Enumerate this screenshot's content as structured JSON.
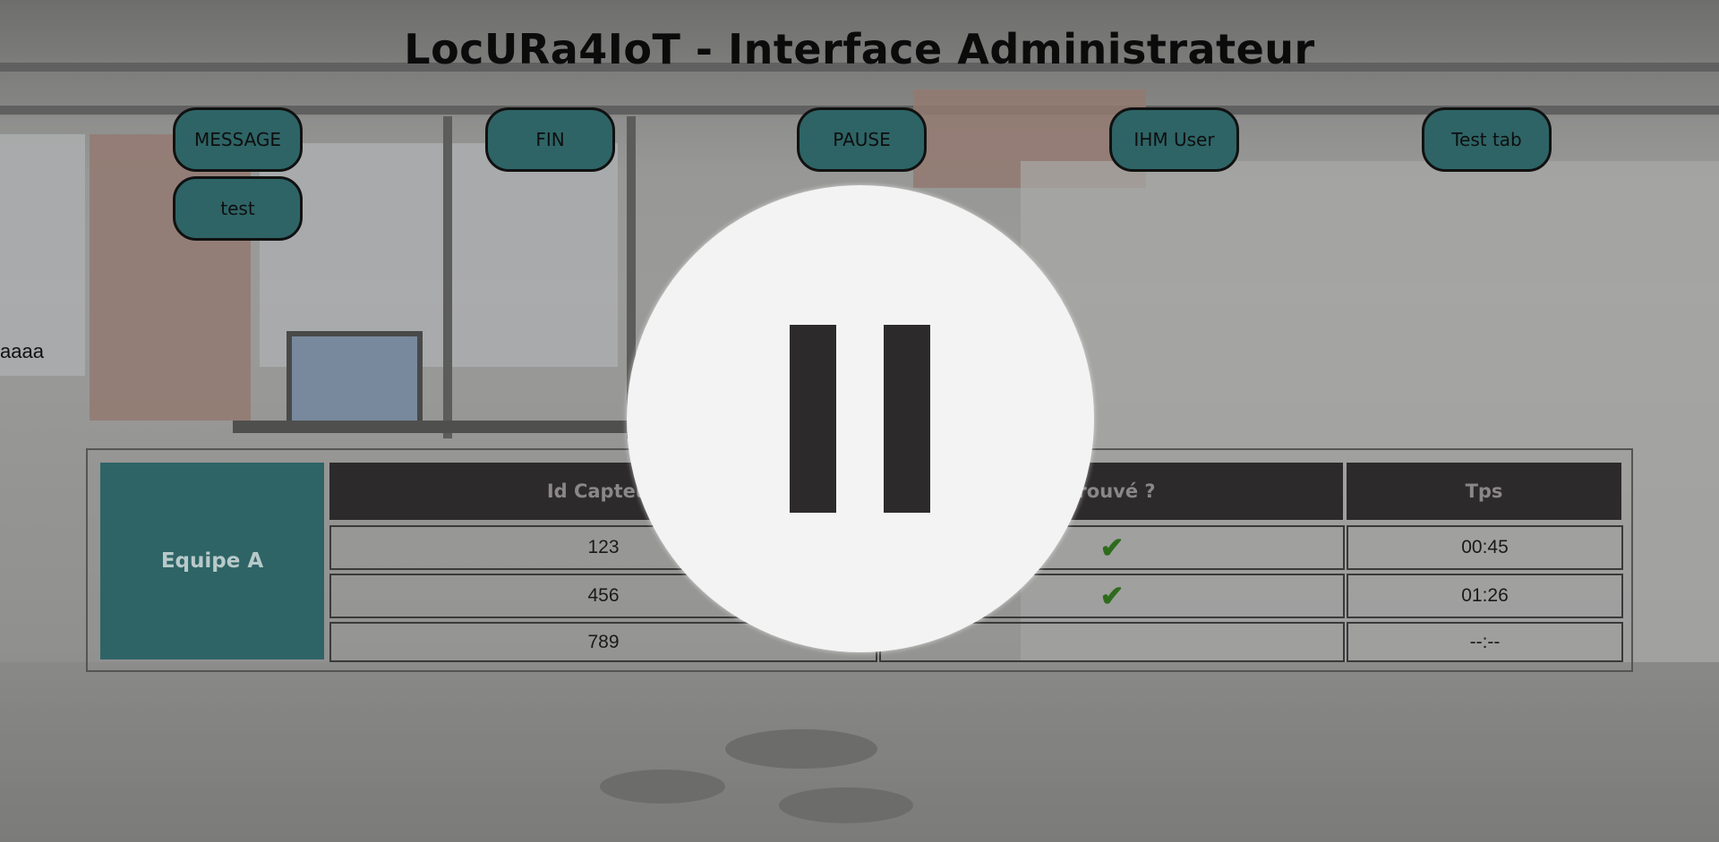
{
  "header": {
    "title": "LocURa4IoT - Interface Administrateur"
  },
  "buttons": {
    "message": "MESSAGE",
    "fin": "FIN",
    "pause": "PAUSE",
    "ihm_user": "IHM User",
    "test_tab": "Test tab",
    "test": "test"
  },
  "stray_text": "aaaa",
  "scoreboard": {
    "team_name": "Equipe A",
    "columns": [
      "Id Capteur",
      "Trouvé ?",
      "Tps"
    ],
    "rows": [
      {
        "id": "123",
        "found": "✔",
        "time": "00:45"
      },
      {
        "id": "456",
        "found": "✔",
        "time": "01:26"
      },
      {
        "id": "789",
        "found": "",
        "time": "--:--"
      }
    ]
  },
  "overlay": {
    "icon": "pause-icon",
    "state": "paused"
  },
  "colors": {
    "button_bg": "#2e6466",
    "header_bg": "#2d2a2b",
    "check": "#2e6b1c",
    "overlay": "#f3f3f3"
  }
}
